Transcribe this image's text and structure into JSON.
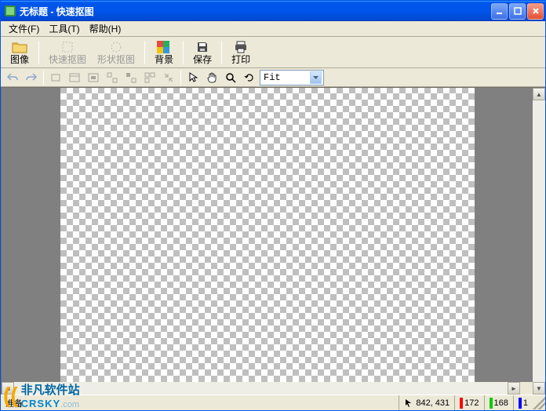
{
  "window": {
    "title": "无标题 - 快速抠图"
  },
  "menu": {
    "file": "文件(F)",
    "tools": "工具(T)",
    "help": "帮助(H)"
  },
  "toolbar": {
    "image": "图像",
    "quick_cut": "快速抠图",
    "shape_cut": "形状抠图",
    "background": "背景",
    "save": "保存",
    "print": "打印"
  },
  "zoom": {
    "value": "Fit"
  },
  "status": {
    "ready": "准备",
    "coords": "842, 431",
    "r": "172",
    "g": "168",
    "b": "1"
  },
  "watermark": {
    "line1": "非凡软件站",
    "line2": "CRSKY",
    "line2_suffix": ".com"
  }
}
